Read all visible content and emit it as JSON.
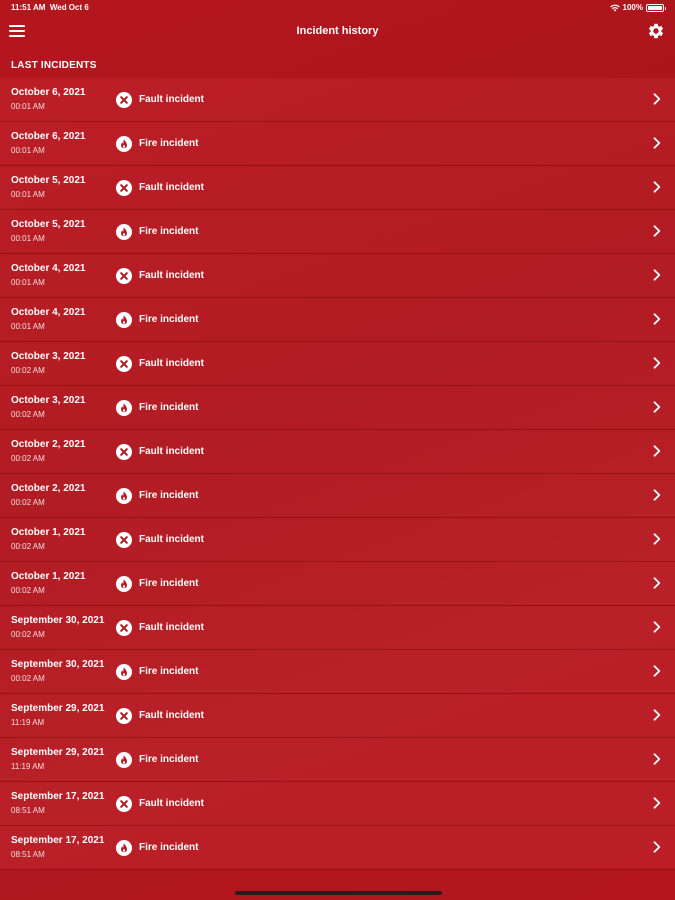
{
  "status_bar": {
    "time": "11:51 AM",
    "date": "Wed Oct 6",
    "battery": "100%",
    "battery_level": 1.0,
    "icons": [
      "wifi-icon",
      "battery-icon"
    ]
  },
  "nav": {
    "title": "Incident history",
    "menu_icon": "hamburger-menu-icon",
    "settings_icon": "gear-icon"
  },
  "section": {
    "title": "LAST INCIDENTS"
  },
  "incidents": [
    {
      "date": "October 6, 2021",
      "time": "00:01 AM",
      "type": "Fault incident",
      "icon": "fault-icon"
    },
    {
      "date": "October 6, 2021",
      "time": "00:01 AM",
      "type": "Fire incident",
      "icon": "fire-icon"
    },
    {
      "date": "October 5, 2021",
      "time": "00:01 AM",
      "type": "Fault incident",
      "icon": "fault-icon"
    },
    {
      "date": "October 5, 2021",
      "time": "00:01 AM",
      "type": "Fire incident",
      "icon": "fire-icon"
    },
    {
      "date": "October 4, 2021",
      "time": "00:01 AM",
      "type": "Fault incident",
      "icon": "fault-icon"
    },
    {
      "date": "October 4, 2021",
      "time": "00:01 AM",
      "type": "Fire incident",
      "icon": "fire-icon"
    },
    {
      "date": "October 3, 2021",
      "time": "00:02 AM",
      "type": "Fault incident",
      "icon": "fault-icon"
    },
    {
      "date": "October 3, 2021",
      "time": "00:02 AM",
      "type": "Fire incident",
      "icon": "fire-icon"
    },
    {
      "date": "October 2, 2021",
      "time": "00:02 AM",
      "type": "Fault incident",
      "icon": "fault-icon"
    },
    {
      "date": "October 2, 2021",
      "time": "00:02 AM",
      "type": "Fire incident",
      "icon": "fire-icon"
    },
    {
      "date": "October 1, 2021",
      "time": "00:02 AM",
      "type": "Fault incident",
      "icon": "fault-icon"
    },
    {
      "date": "October 1, 2021",
      "time": "00:02 AM",
      "type": "Fire incident",
      "icon": "fire-icon"
    },
    {
      "date": "September 30, 2021",
      "time": "00:02 AM",
      "type": "Fault incident",
      "icon": "fault-icon"
    },
    {
      "date": "September 30, 2021",
      "time": "00:02 AM",
      "type": "Fire incident",
      "icon": "fire-icon"
    },
    {
      "date": "September 29, 2021",
      "time": "11:19 AM",
      "type": "Fault incident",
      "icon": "fault-icon"
    },
    {
      "date": "September 29, 2021",
      "time": "11:19 AM",
      "type": "Fire incident",
      "icon": "fire-icon"
    },
    {
      "date": "September 17, 2021",
      "time": "08:51 AM",
      "type": "Fault incident",
      "icon": "fault-icon"
    },
    {
      "date": "September 17, 2021",
      "time": "08:51 AM",
      "type": "Fire incident",
      "icon": "fire-icon"
    }
  ],
  "colors": {
    "background": "#b01820",
    "icon_glyph": "#b01820",
    "text": "#ffffff"
  }
}
